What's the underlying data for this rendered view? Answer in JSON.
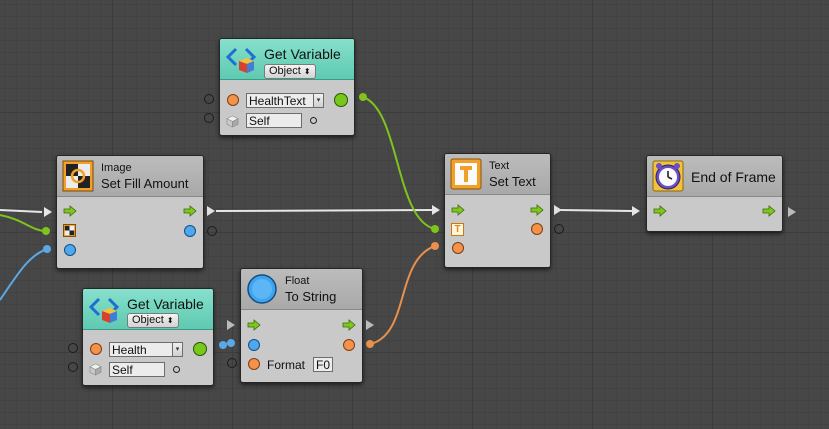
{
  "colors": {
    "canvas": "#474747",
    "flow_wire": "#e6e6e6",
    "object_wire": "#7fc31c",
    "float_wire": "#5aa9e6",
    "string_wire": "#e8904c",
    "header_teal": "#6fd4bc",
    "node_body": "#c9c9c9"
  },
  "nodes": {
    "get_variable_top": {
      "title": "Get Variable",
      "kind_dropdown": "Object",
      "name_value": "HealthText",
      "target_value": "Self",
      "icon": "variable-icon"
    },
    "set_fill_amount": {
      "category": "Image",
      "name": "Set Fill Amount",
      "icon": "image-icon"
    },
    "set_text": {
      "category": "Text",
      "name": "Set Text",
      "icon": "text-icon",
      "text_port_glyph": "T"
    },
    "end_of_frame": {
      "title": "End of Frame",
      "icon": "clock-icon"
    },
    "get_variable_bottom": {
      "title": "Get Variable",
      "kind_dropdown": "Object",
      "name_value": "Health",
      "target_value": "Self",
      "icon": "variable-icon"
    },
    "to_string": {
      "category": "Float",
      "name": "To String",
      "icon": "float-icon",
      "format_label": "Format",
      "format_value": "F0"
    }
  }
}
